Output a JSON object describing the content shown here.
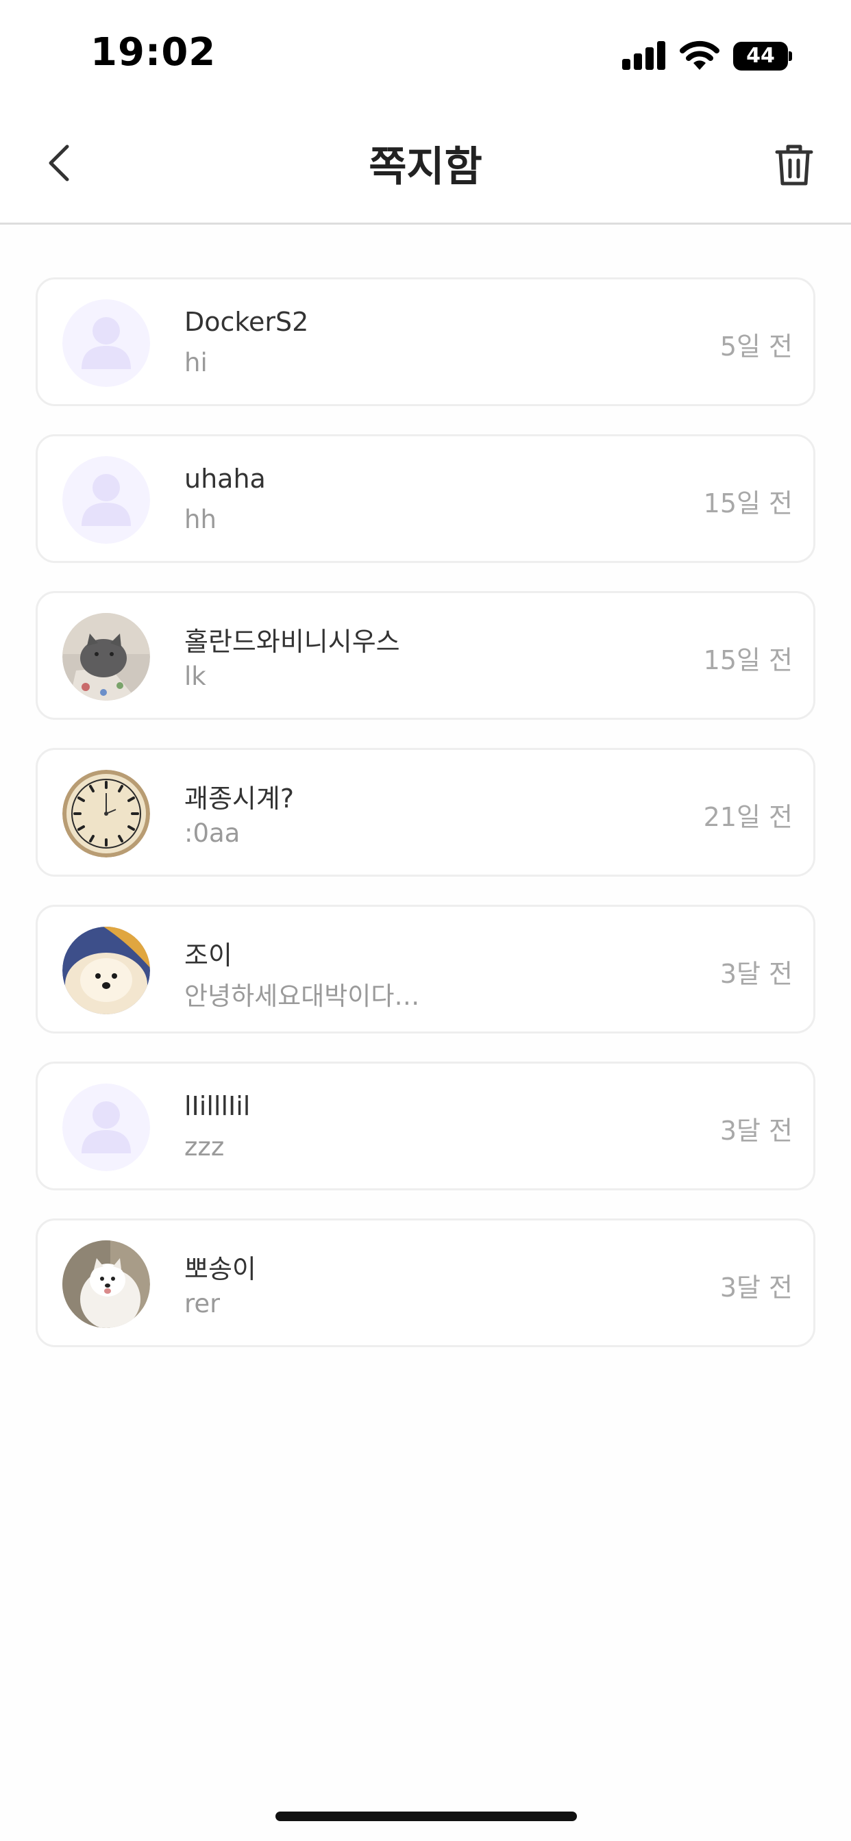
{
  "status_bar": {
    "time": "19:02",
    "battery": "44"
  },
  "nav": {
    "title": "쪽지함"
  },
  "messages": [
    {
      "sender": "DockerS2",
      "preview": "hi",
      "time": "5일 전",
      "avatar": "default-avatar-icon"
    },
    {
      "sender": "uhaha",
      "preview": "hh",
      "time": "15일 전",
      "avatar": "default-avatar-icon"
    },
    {
      "sender": "홀란드와비니시우스",
      "preview": "lk",
      "time": "15일 전",
      "avatar": "cat-photo"
    },
    {
      "sender": "괘종시계?",
      "preview": ":0aa",
      "time": "21일 전",
      "avatar": "clock-photo"
    },
    {
      "sender": "조이",
      "preview": "안녕하세요대박이다…",
      "time": "3달 전",
      "avatar": "pomeranian-photo"
    },
    {
      "sender": "lIilllIil",
      "preview": "zzz",
      "time": "3달 전",
      "avatar": "default-avatar-icon"
    },
    {
      "sender": "뽀송이",
      "preview": "rer",
      "time": "3달 전",
      "avatar": "samoyed-photo"
    }
  ],
  "colors": {
    "default_avatar_bg": "#f5f3ff",
    "default_avatar_fg": "#e6e1fb"
  }
}
